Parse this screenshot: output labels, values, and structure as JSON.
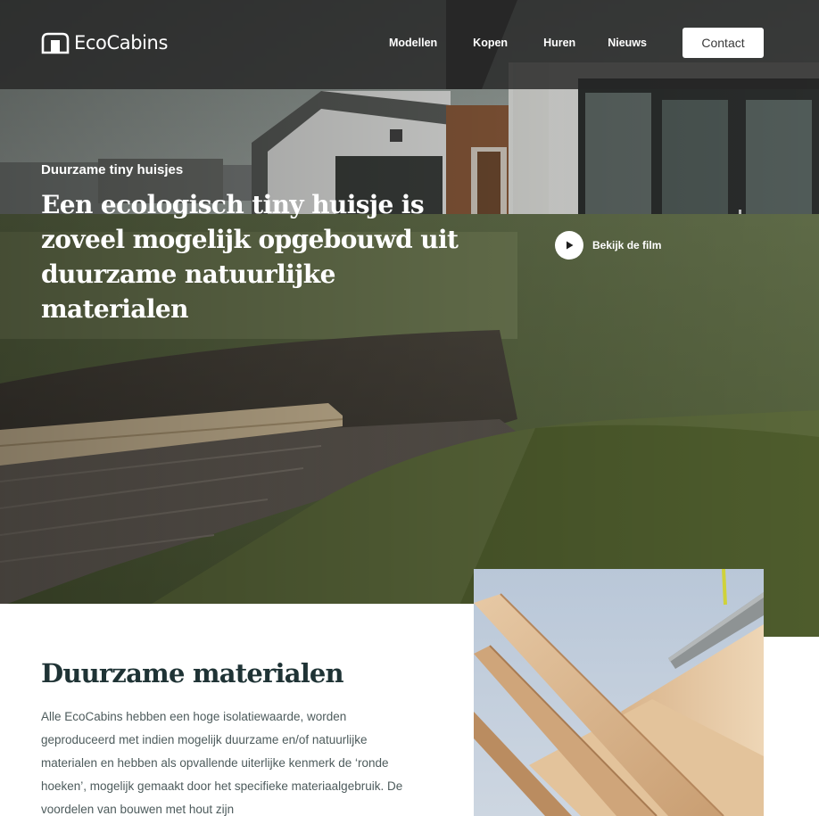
{
  "header": {
    "logo_text": "EcoCabins",
    "nav": [
      "Modellen",
      "Kopen",
      "Huren",
      "Nieuws"
    ],
    "contact_label": "Contact"
  },
  "hero": {
    "kicker": "Duurzame tiny huisjes",
    "title": "Een ecologisch tiny huisje is zoveel mogelijk opgebouwd uit duurzame natuurlijke materialen",
    "play_label": "Bekijk de film"
  },
  "section": {
    "title": "Duurzame materialen",
    "body": "Alle EcoCabins hebben een hoge isolatiewaarde, worden geproduceerd met indien mogelijk duurzame en/of natuurlijke materialen en hebben als opvallende uiterlijke kenmerk de ‘ronde hoeken’, mogelijk gemaakt door het specifieke materiaalgebruik. De voordelen van bouwen met hout zijn"
  },
  "icons": {
    "logo": "cabin-logo-icon",
    "play": "play-icon"
  },
  "colors": {
    "header_bg": "#262626",
    "heading": "#1f3335",
    "body_text": "#4d5b5c",
    "button_bg": "#ffffff"
  }
}
